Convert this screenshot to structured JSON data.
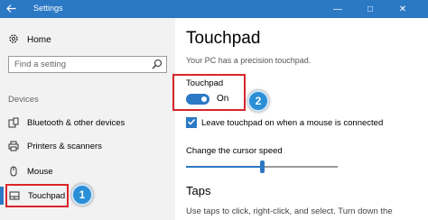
{
  "window": {
    "title": "Settings",
    "back_icon": "arrow-left-icon",
    "titlebar_color": "#2b78c5",
    "minimize_glyph": "—",
    "maximize_glyph": "□",
    "close_glyph": "✕"
  },
  "sidebar": {
    "home_label": "Home",
    "search_placeholder": "Find a setting",
    "section_label": "Devices",
    "items": [
      {
        "label": "Bluetooth & other devices",
        "icon": "bluetooth-devices-icon"
      },
      {
        "label": "Printers & scanners",
        "icon": "printer-icon"
      },
      {
        "label": "Mouse",
        "icon": "mouse-icon"
      },
      {
        "label": "Touchpad",
        "icon": "touchpad-icon",
        "selected": true
      }
    ]
  },
  "annotations": {
    "badge1": "1",
    "badge2": "2",
    "highlight_color": "#d9262b",
    "badge_color": "#2a8fd6"
  },
  "main": {
    "title": "Touchpad",
    "subtitle": "Your PC has a precision touchpad.",
    "touchpad_toggle": {
      "label": "Touchpad",
      "state": "On",
      "on": true
    },
    "leave_on_checkbox": {
      "label": "Leave touchpad on when a mouse is connected",
      "checked": true
    },
    "cursor_speed": {
      "label": "Change the cursor speed",
      "value_fraction": 0.5
    },
    "taps": {
      "title": "Taps",
      "description": "Use taps to click, right-click, and select. Turn down the"
    }
  }
}
